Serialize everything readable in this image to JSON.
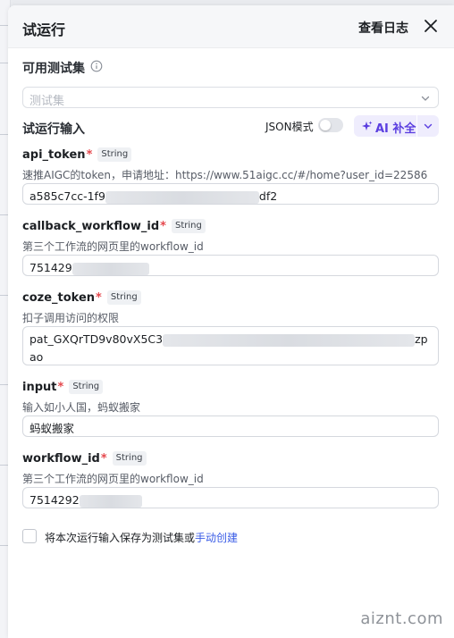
{
  "header": {
    "title": "试运行",
    "log_link": "查看日志"
  },
  "testset": {
    "label": "可用测试集",
    "placeholder": "测试集"
  },
  "run_input": {
    "label": "试运行输入",
    "json_mode_label": "JSON模式",
    "json_mode_on": false,
    "ai_button_label": "AI 补全"
  },
  "fields": [
    {
      "name": "api_token",
      "required": "*",
      "type": "String",
      "description": "速推AIGC的token，申请地址：https://www.51aigc.cc/#/home?user_id=22586",
      "value_start": "a585c7cc-1f9",
      "value_end": "df2"
    },
    {
      "name": "callback_workflow_id",
      "required": "*",
      "type": "String",
      "description": "第三个工作流的网页里的workflow_id",
      "value_start": "751429",
      "value_end": ""
    },
    {
      "name": "coze_token",
      "required": "*",
      "type": "String",
      "description": "扣子调用访问的权限",
      "value_start": "pat_GXQrTD9v80vX5C3",
      "value_end": "zp",
      "value_line2": "ao"
    },
    {
      "name": "input",
      "required": "*",
      "type": "String",
      "description": "输入如小人国，蚂蚁搬家",
      "value_start": "蚂蚁搬家",
      "value_end": ""
    },
    {
      "name": "workflow_id",
      "required": "*",
      "type": "String",
      "description": "第三个工作流的网页里的workflow_id",
      "value_start": "7514292",
      "value_end": ""
    }
  ],
  "footer": {
    "save_text": "将本次运行输入保存为测试集或",
    "create_link": "手动创建"
  },
  "watermark": "aiznt.com",
  "colors": {
    "accent": "#5b3fe0",
    "link": "#3a5ce6",
    "required": "#e5484d"
  }
}
